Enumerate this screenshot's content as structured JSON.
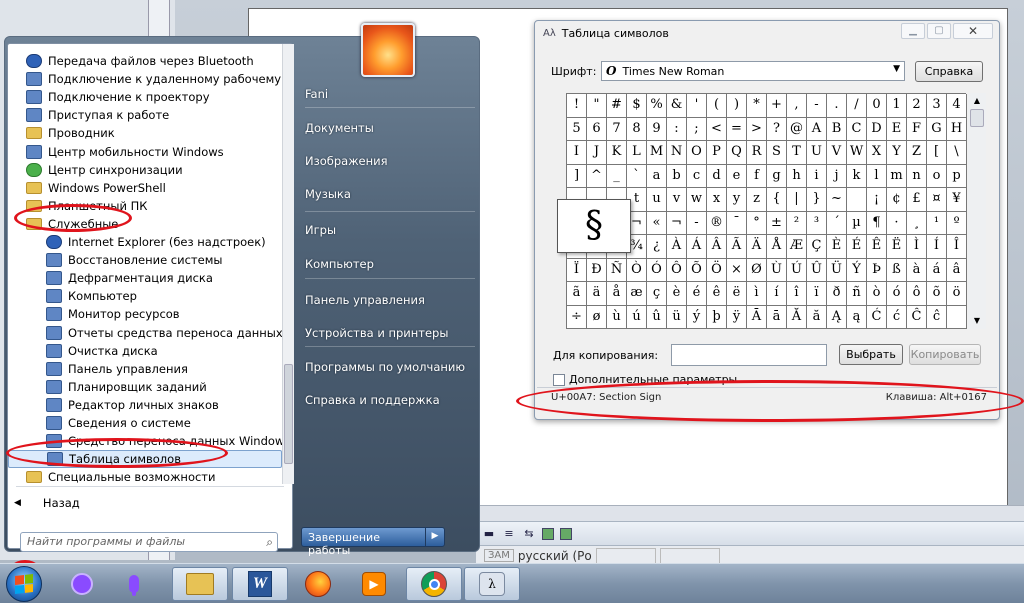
{
  "start_menu": {
    "programs": [
      {
        "label": "Передача файлов через Bluetooth",
        "icon": "bluetooth-icon"
      },
      {
        "label": "Подключение к удаленному рабочему стол",
        "icon": "remote-desktop-icon"
      },
      {
        "label": "Подключение к проектору",
        "icon": "projector-icon"
      },
      {
        "label": "Приступая к работе",
        "icon": "getting-started-icon"
      },
      {
        "label": "Проводник",
        "icon": "folder-icon"
      },
      {
        "label": "Центр мобильности Windows",
        "icon": "mobility-center-icon"
      },
      {
        "label": "Центр синхронизации",
        "icon": "sync-center-icon"
      },
      {
        "label": "Windows PowerShell",
        "icon": "folder-icon"
      },
      {
        "label": "Планшетный ПК",
        "icon": "folder-icon"
      },
      {
        "label": "Служебные",
        "icon": "folder-icon"
      },
      {
        "label": "Internet Explorer (без надстроек)",
        "icon": "internet-explorer-icon"
      },
      {
        "label": "Восстановление системы",
        "icon": "system-restore-icon"
      },
      {
        "label": "Дефрагментация диска",
        "icon": "defrag-icon"
      },
      {
        "label": "Компьютер",
        "icon": "computer-icon"
      },
      {
        "label": "Монитор ресурсов",
        "icon": "resource-monitor-icon"
      },
      {
        "label": "Отчеты средства переноса данных Wind",
        "icon": "transfer-reports-icon"
      },
      {
        "label": "Очистка диска",
        "icon": "disk-cleanup-icon"
      },
      {
        "label": "Панель управления",
        "icon": "control-panel-icon"
      },
      {
        "label": "Планировщик заданий",
        "icon": "task-scheduler-icon"
      },
      {
        "label": "Редактор личных знаков",
        "icon": "char-editor-icon"
      },
      {
        "label": "Сведения о системе",
        "icon": "system-info-icon"
      },
      {
        "label": "Средство переноса данных Windows",
        "icon": "easy-transfer-icon"
      },
      {
        "label": "Таблица символов",
        "icon": "character-map-icon"
      },
      {
        "label": "Специальные возможности",
        "icon": "folder-icon"
      }
    ],
    "back_label": "Назад",
    "search_placeholder": "Найти программы и файлы",
    "right_items": [
      "Fani",
      "Документы",
      "Изображения",
      "Музыка",
      "Игры",
      "Компьютер",
      "Панель управления",
      "Устройства и принтеры",
      "Программы по умолчанию",
      "Справка и поддержка"
    ],
    "shutdown_label": "Завершение работы"
  },
  "charmap": {
    "title": "Таблица символов",
    "font_label": "Шрифт:",
    "font_value": "Times New Roman",
    "help_button": "Справка",
    "zoom_char": "§",
    "copy_label": "Для копирования:",
    "copy_value": "",
    "select_button": "Выбрать",
    "copy_button": "Копировать",
    "advanced_label": "Дополнительные параметры",
    "status_left": "U+00A7: Section Sign",
    "status_right": "Клавиша: Alt+0167",
    "rows": [
      [
        "!",
        "\"",
        "#",
        "$",
        "%",
        "&",
        "'",
        "(",
        ")",
        "*",
        "+",
        ",",
        "-",
        ".",
        "/",
        "0",
        "1",
        "2",
        "3",
        "4"
      ],
      [
        "5",
        "6",
        "7",
        "8",
        "9",
        ":",
        ";",
        "<",
        "=",
        ">",
        "?",
        "@",
        "A",
        "B",
        "C",
        "D",
        "E",
        "F",
        "G",
        "H"
      ],
      [
        "I",
        "J",
        "K",
        "L",
        "M",
        "N",
        "O",
        "P",
        "Q",
        "R",
        "S",
        "T",
        "U",
        "V",
        "W",
        "X",
        "Y",
        "Z",
        "[",
        "\\"
      ],
      [
        "]",
        "^",
        "_",
        "`",
        "a",
        "b",
        "c",
        "d",
        "e",
        "f",
        "g",
        "h",
        "i",
        "j",
        "k",
        "l",
        "m",
        "n",
        "o",
        "p"
      ],
      [
        "",
        "",
        "",
        "t",
        "u",
        "v",
        "w",
        "x",
        "y",
        "z",
        "{",
        "|",
        "}",
        "~",
        "",
        "¡",
        "¢",
        "£",
        "¤",
        "¥"
      ],
      [
        "",
        "",
        "",
        "¬",
        "«",
        "¬",
        "-",
        "®",
        "¯",
        "°",
        "±",
        "²",
        "³",
        "´",
        "µ",
        "¶",
        "·",
        "¸",
        "¹",
        "º"
      ],
      [
        "",
        "",
        "",
        "¾",
        "¿",
        "À",
        "Á",
        "Â",
        "Ã",
        "Ä",
        "Å",
        "Æ",
        "Ç",
        "È",
        "É",
        "Ê",
        "Ë",
        "Ì",
        "Í",
        "Î"
      ],
      [
        "Ï",
        "Ð",
        "Ñ",
        "Ò",
        "Ó",
        "Ô",
        "Õ",
        "Ö",
        "×",
        "Ø",
        "Ù",
        "Ú",
        "Û",
        "Ü",
        "Ý",
        "Þ",
        "ß",
        "à",
        "á",
        "â"
      ],
      [
        "ã",
        "ä",
        "å",
        "æ",
        "ç",
        "è",
        "é",
        "ê",
        "ë",
        "ì",
        "í",
        "î",
        "ï",
        "ð",
        "ñ",
        "ò",
        "ó",
        "ô",
        "õ",
        "ö"
      ],
      [
        "÷",
        "ø",
        "ù",
        "ú",
        "û",
        "ü",
        "ý",
        "þ",
        "ÿ",
        "Ā",
        "ā",
        "Ă",
        "ă",
        "Ą",
        "ą",
        "Ć",
        "ć",
        "Ĉ",
        "ĉ",
        ""
      ]
    ]
  },
  "editor": {
    "status_zam": "ЗАМ",
    "status_lang": "русский (Ро"
  },
  "colors": {
    "annotation": "#e0141c",
    "menu_blue": "#3c4d60"
  }
}
